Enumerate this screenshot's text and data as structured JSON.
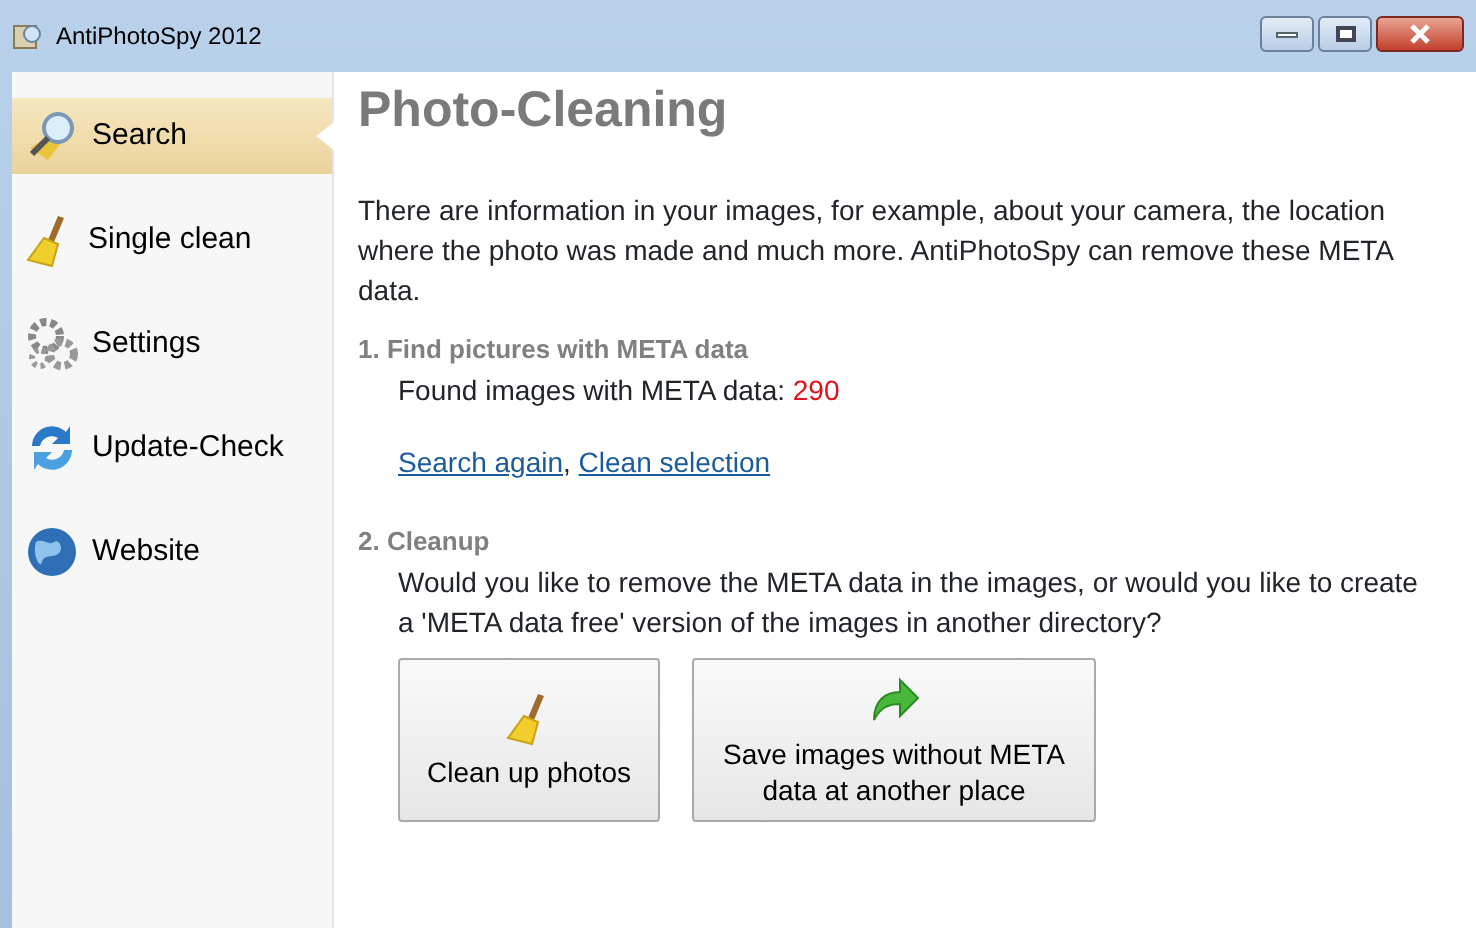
{
  "window": {
    "title": "AntiPhotoSpy 2012"
  },
  "sidebar": {
    "items": [
      {
        "label": "Search",
        "kind": "search",
        "selected": true
      },
      {
        "label": "Single clean",
        "kind": "broom",
        "selected": false
      },
      {
        "label": "Settings",
        "kind": "gears",
        "selected": false
      },
      {
        "label": "Update-Check",
        "kind": "refresh",
        "selected": false
      },
      {
        "label": "Website",
        "kind": "globe",
        "selected": false
      }
    ]
  },
  "content": {
    "title": "Photo-Cleaning",
    "intro": "There are information in your images, for example, about your camera, the location where the photo was made and much more. AntiPhotoSpy can remove these META data.",
    "step_1": {
      "heading": "1. Find pictures with META data",
      "found_label": "Found images with META data:",
      "found_count": "290",
      "links": [
        "Search again",
        "Clean selection"
      ],
      "separator": ","
    },
    "step_2": {
      "heading": "2. Cleanup",
      "text": "Would you like to remove the META data in the images, or would you like to create a 'META data free' version of the images in another directory?",
      "buttons": [
        {
          "label": "Clean up photos",
          "kind": "broom"
        },
        {
          "label": "Save images without META data at another place",
          "kind": "arrow"
        }
      ]
    }
  }
}
